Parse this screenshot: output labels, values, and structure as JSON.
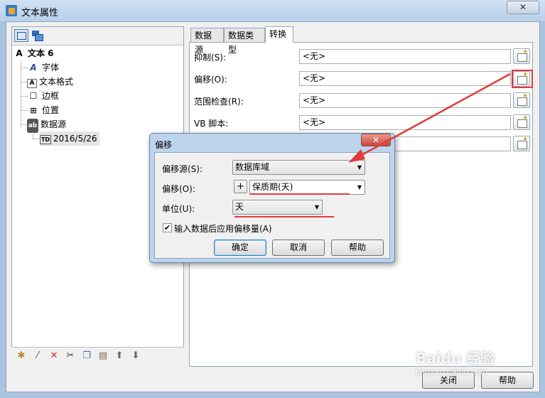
{
  "window": {
    "title": "文本属性",
    "close": "✕"
  },
  "left_panel": {
    "tree": {
      "root": "文本 6",
      "items": [
        "字体",
        "文本格式",
        "边框",
        "位置",
        "数据源"
      ],
      "leaf": "2016/5/26"
    }
  },
  "tabs": [
    "数据源",
    "数据类型",
    "转换"
  ],
  "rows": [
    {
      "label": "抑制(S):",
      "value": "<无>"
    },
    {
      "label": "偏移(O):",
      "value": "<无>"
    },
    {
      "label": "范围检查(R):",
      "value": "<无>"
    },
    {
      "label": "VB 脚本:",
      "value": "<无>"
    },
    {
      "label": "",
      "value": ""
    }
  ],
  "buttons": {
    "close": "关闭",
    "help": "帮助"
  },
  "dialog": {
    "title": "偏移",
    "close": "✕",
    "source_label": "偏移源(S):",
    "source_value": "数据库域",
    "offset_label": "偏移(O):",
    "offset_plus": "+",
    "offset_value": "保质期(天)",
    "unit_label": "单位(U):",
    "unit_value": "天",
    "checkbox_label": "输入数据后应用偏移量(A)",
    "checkbox_checked": true,
    "ok": "确定",
    "cancel": "取消",
    "help": "帮助"
  },
  "watermark": {
    "brand": "Baidu 经验",
    "url": "jingyan.baidu.com"
  },
  "colors": {
    "annotation": "#e23b3b",
    "title_bar": "#b9d0ea",
    "dialog_frame": "#bcd3ec"
  }
}
